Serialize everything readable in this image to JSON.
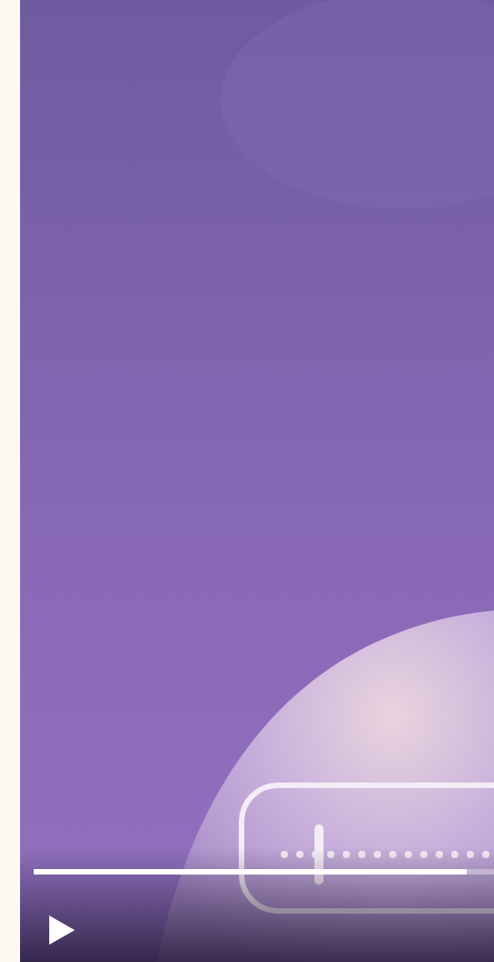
{
  "player": {
    "playing": false,
    "progress": {
      "level": 0.94
    }
  }
}
